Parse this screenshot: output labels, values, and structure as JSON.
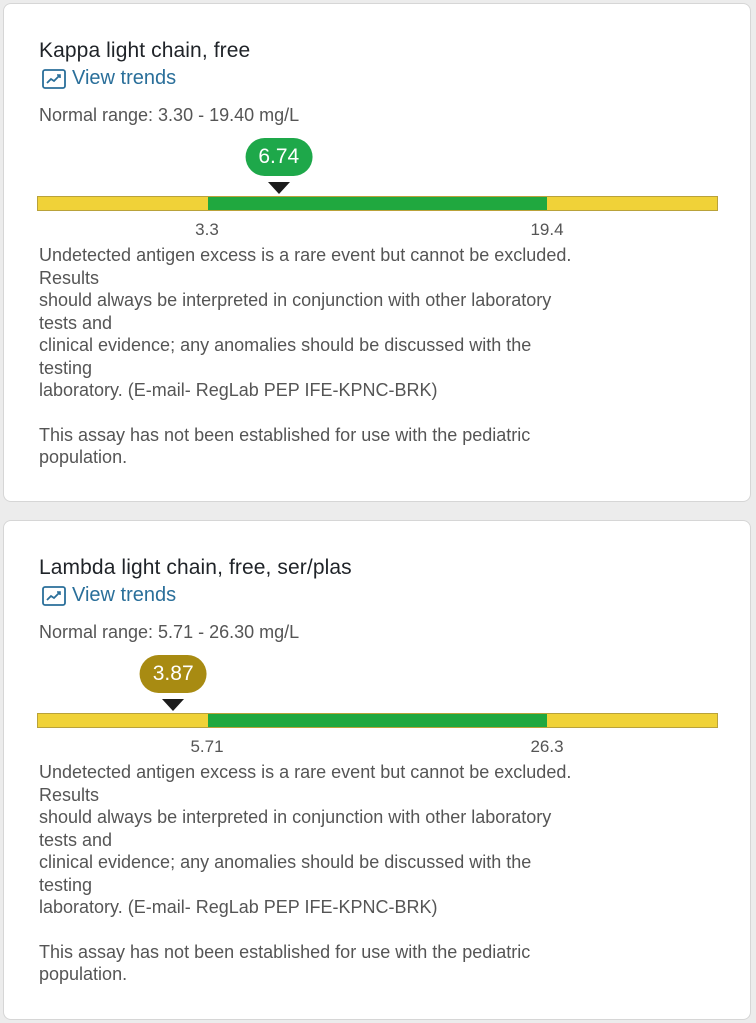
{
  "colors": {
    "in_range": "#1ea84a",
    "low_bubble": "#a88b12",
    "bar_green": "#20a83f",
    "bar_yellow": "#f0d238",
    "link": "#2a6f9a"
  },
  "results": [
    {
      "title": "Kappa light chain, free",
      "trends_label": "View trends",
      "trends_icon": "trend-chart-icon",
      "normal_range": "Normal range: 3.30 - 19.40 mg/L",
      "value": "6.74",
      "value_status": "normal",
      "value_fraction": 0.355,
      "low_tick": "3.3",
      "high_tick": "19.4",
      "comment_lines": [
        "Undetected antigen excess is a rare event but cannot be excluded.",
        "Results",
        "should always be interpreted in conjunction with other laboratory",
        "tests and",
        "clinical evidence; any anomalies should be discussed with the",
        "testing",
        "laboratory. (E-mail- RegLab PEP IFE-KPNC-BRK)"
      ],
      "note_lines": [
        "This assay has not been established for use with the pediatric",
        "population."
      ]
    },
    {
      "title": "Lambda light chain, free, ser/plas",
      "trends_label": "View trends",
      "trends_icon": "trend-chart-icon",
      "normal_range": "Normal range: 5.71 - 26.30 mg/L",
      "value": "3.87",
      "value_status": "low",
      "value_fraction": 0.2,
      "low_tick": "5.71",
      "high_tick": "26.3",
      "comment_lines": [
        "Undetected antigen excess is a rare event but cannot be excluded.",
        "Results",
        "should always be interpreted in conjunction with other laboratory",
        "tests and",
        "clinical evidence; any anomalies should be discussed with the",
        "testing",
        "laboratory. (E-mail- RegLab PEP IFE-KPNC-BRK)"
      ],
      "note_lines": [
        "This assay has not been established for use with the pediatric",
        "population."
      ]
    }
  ]
}
